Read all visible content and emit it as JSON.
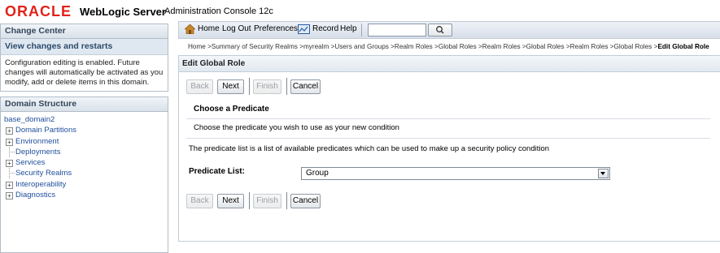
{
  "header": {
    "brand": "ORACLE",
    "product": "WebLogic Server",
    "subtitle": "Administration Console 12c"
  },
  "change_center": {
    "title": "Change Center",
    "view_link": "View changes and restarts",
    "message": "Configuration editing is enabled. Future changes will automatically be activated as you modify, add or delete items in this domain."
  },
  "domain_structure": {
    "title": "Domain Structure",
    "root": "base_domain2",
    "items": [
      {
        "label": "Domain Partitions",
        "expandable": true
      },
      {
        "label": "Environment",
        "expandable": true
      },
      {
        "label": "Deployments",
        "expandable": false
      },
      {
        "label": "Services",
        "expandable": true
      },
      {
        "label": "Security Realms",
        "expandable": false
      },
      {
        "label": "Interoperability",
        "expandable": true
      },
      {
        "label": "Diagnostics",
        "expandable": true
      }
    ]
  },
  "toolbar": {
    "home": "Home",
    "logout": "Log Out",
    "preferences": "Preferences",
    "record": "Record",
    "help": "Help",
    "search_value": ""
  },
  "breadcrumb": {
    "path": "Home >Summary of Security Realms >myrealm >Users and Groups >Realm Roles >Global Roles >Realm Roles >Global Roles >Realm Roles >Global Roles >",
    "current": "Edit Global Role"
  },
  "form": {
    "title": "Edit Global Role",
    "back": "Back",
    "next": "Next",
    "finish": "Finish",
    "cancel": "Cancel",
    "section_title": "Choose a Predicate",
    "section_sub": "Choose the predicate you wish to use as your new condition",
    "description": "The predicate list is a list of available predicates which can be used to make up a security policy condition",
    "predicate_label": "Predicate List:",
    "predicate_value": "Group"
  },
  "colors": {
    "brand_red": "#e2231a",
    "link_blue": "#1f4e9c"
  }
}
